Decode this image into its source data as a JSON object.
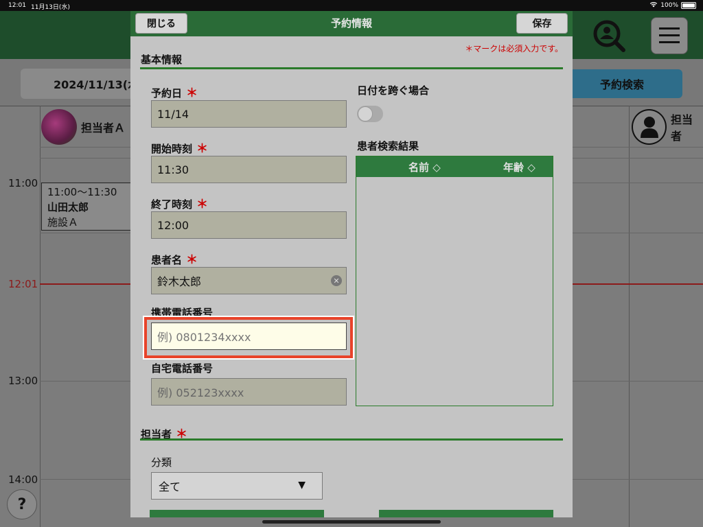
{
  "status_bar": {
    "time": "12:01",
    "date": "11月13日(水)",
    "battery": "100%"
  },
  "background": {
    "date_button": "2024/11/13(水",
    "reservation_search": "予約検索",
    "staff_left": "担当者Ａ",
    "staff_right": "担当者",
    "times": [
      "11:00",
      "12:01",
      "13:00",
      "14:00"
    ],
    "appointment": {
      "time": "11:00～11:30",
      "patient": "山田太郎",
      "facility": "施設Ａ"
    },
    "help": "?"
  },
  "modal": {
    "title": "予約情報",
    "close_label": "閉じる",
    "save_label": "保存",
    "required_note": "＊マークは必須入力です。",
    "required_mark": "＊",
    "section_basic": "基本情報",
    "fields": {
      "reservation_date": {
        "label": "予約日",
        "value": "11/14"
      },
      "start_time": {
        "label": "開始時刻",
        "value": "11:30"
      },
      "end_time": {
        "label": "終了時刻",
        "value": "12:00"
      },
      "patient_name": {
        "label": "患者名",
        "value": "鈴木太郎"
      },
      "mobile_phone": {
        "label": "携帯電話番号",
        "placeholder": "例) 0801234xxxx"
      },
      "home_phone": {
        "label": "自宅電話番号",
        "placeholder": "例) 052123xxxx"
      }
    },
    "cross_date_label": "日付を跨ぐ場合",
    "patient_results": {
      "label": "患者検索結果",
      "col_name": "名前 ◇",
      "col_age": "年齢 ◇"
    },
    "section_staff": "担当者",
    "category": {
      "label": "分類",
      "value": "全て",
      "arrow": "▼"
    }
  },
  "colors": {
    "header_green": "#2a6b37",
    "accent_red": "#e8432a",
    "required_red": "#cc0000"
  }
}
